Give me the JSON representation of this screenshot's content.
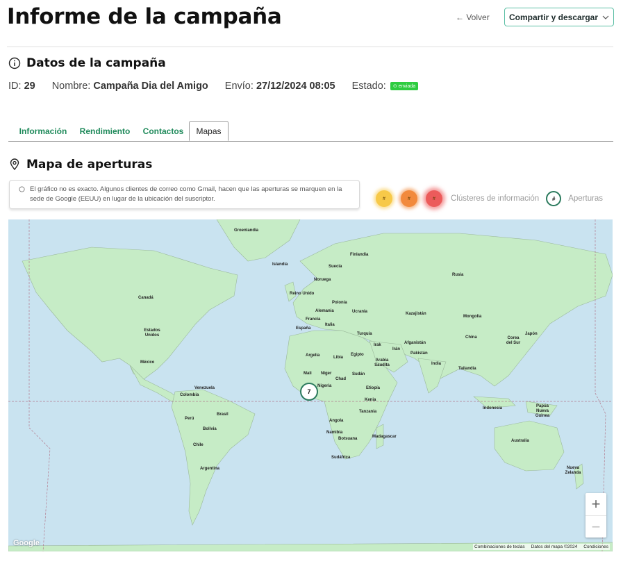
{
  "header": {
    "title": "Informe de la campaña",
    "back_label": "← Volver",
    "share_label": "Compartir y descargar"
  },
  "campaign": {
    "section_title": "Datos de la campaña",
    "id_label": "ID:",
    "id_value": "29",
    "name_label": "Nombre:",
    "name_value": "Campaña Dia del Amigo",
    "send_label": "Envío:",
    "send_value": "27/12/2024 08:05",
    "status_label": "Estado:",
    "status_value": "enviada"
  },
  "tabs": [
    {
      "label": "Información",
      "active": false
    },
    {
      "label": "Rendimiento",
      "active": false
    },
    {
      "label": "Contactos",
      "active": false
    },
    {
      "label": "Mapas",
      "active": true
    }
  ],
  "map_section": {
    "title": "Mapa de aperturas",
    "notice": "El gráfico no es exacto. Algunos clientes de correo como Gmail, hacen que las aperturas se marquen en la sede de Google (EEUU) en lugar de la ubicación del suscriptor.",
    "legend": {
      "cluster_symbol": "#",
      "clusters_label": "Clústeres de información",
      "opens_symbol": "#",
      "opens_label": "Aperturas"
    }
  },
  "map": {
    "marker_count": "7",
    "zoom_in": "+",
    "zoom_out": "−",
    "google_logo": "Google",
    "attribution": [
      "Combinaciones de teclas",
      "Datos del mapa ©2024",
      "Condiciones"
    ],
    "labels": [
      "Groenlandia",
      "Finlandia",
      "Islandia",
      "Suecia",
      "Noruega",
      "Rusia",
      "Reino Unido",
      "Polonia",
      "Alemania",
      "Ucrania",
      "Canadá",
      "Kazajistán",
      "Mongolia",
      "Francia",
      "España",
      "Italia",
      "Turquía",
      "Estados Unidos",
      "China",
      "Corea del Sur",
      "Japón",
      "Afganistán",
      "Irak",
      "Irán",
      "Pakistán",
      "Argelia",
      "Libia",
      "Egipto",
      "Arabia Saudita",
      "India",
      "México",
      "Tailandia",
      "Mali",
      "Níger",
      "Chad",
      "Sudán",
      "Nigeria",
      "Etiopía",
      "Venezuela",
      "Colombia",
      "Kenia",
      "Indonesia",
      "Tanzania",
      "Papúa Nueva Guinea",
      "Perú",
      "Brasil",
      "Angola",
      "Bolivia",
      "Namibia",
      "Botsuana",
      "Madagascar",
      "Australia",
      "Chile",
      "Sudáfrica",
      "Argentina",
      "Nueva Zelanda"
    ],
    "colors": {
      "water": "#c9e3f0",
      "land": "#c6ecc6",
      "marker_border": "#2b7a5d"
    }
  },
  "colors": {
    "accent": "#1f8a5b",
    "button_border": "#5cbfa5",
    "badge": "#2ecc40"
  }
}
